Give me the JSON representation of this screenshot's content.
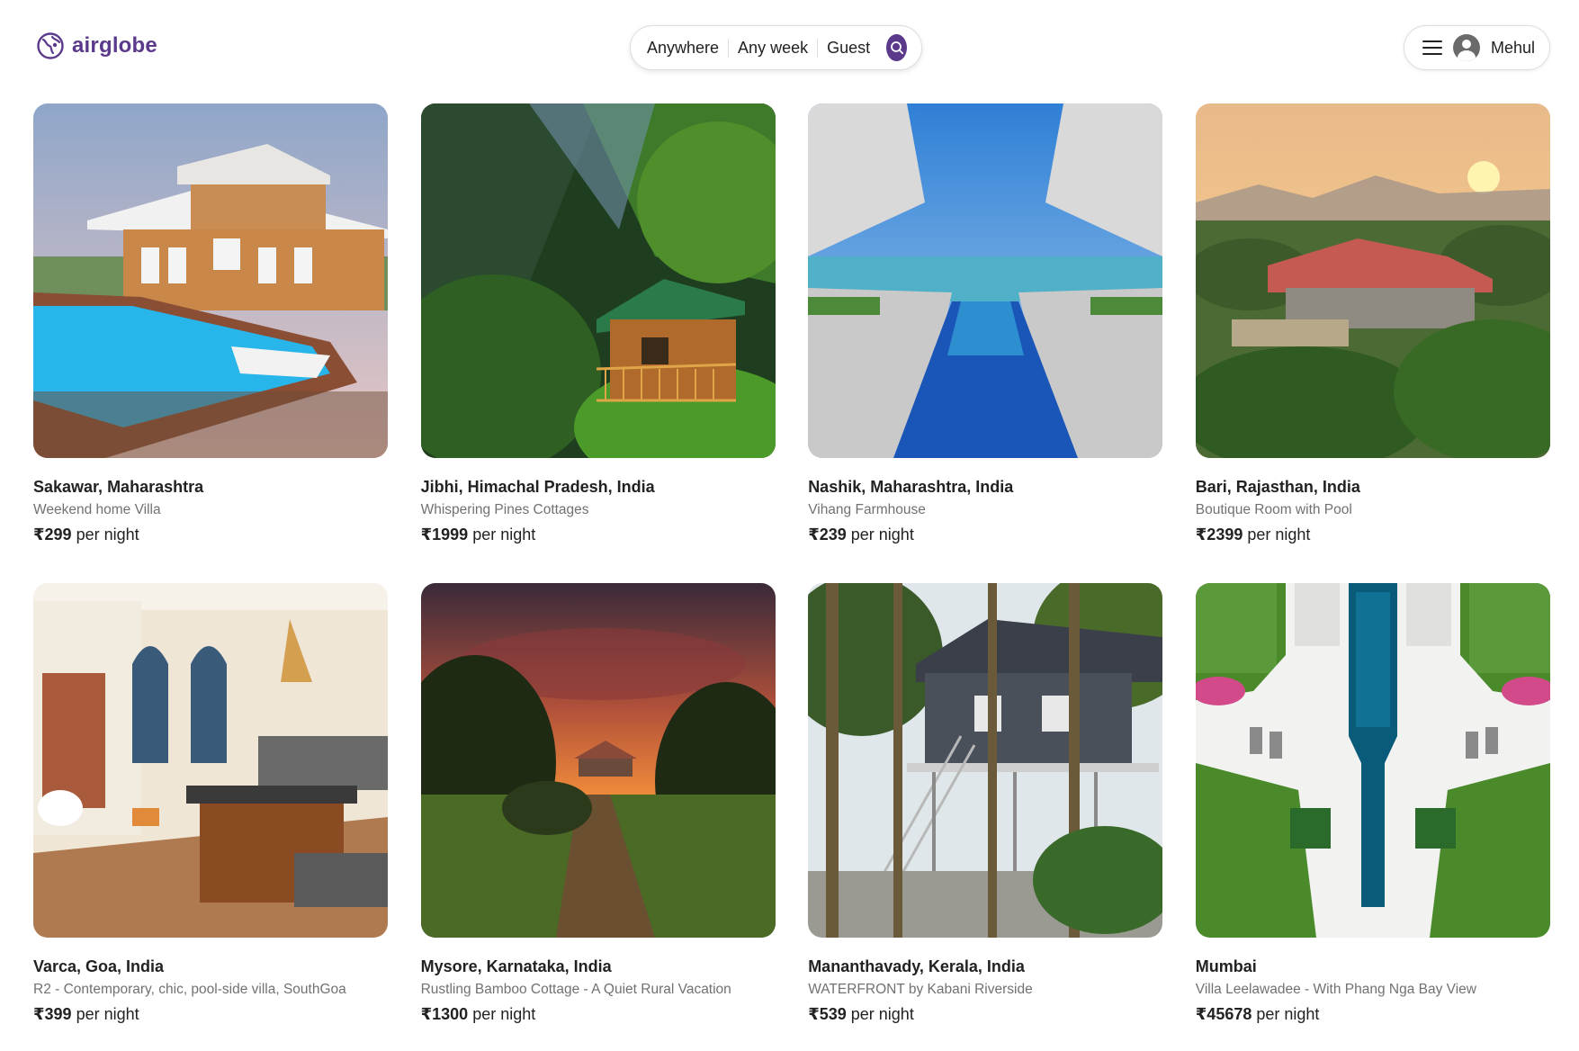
{
  "brand": {
    "name": "airglobe",
    "color": "#5b3a8c"
  },
  "search": {
    "segments": [
      "Anywhere",
      "Any week",
      "Guest"
    ],
    "icon": "search-icon"
  },
  "user": {
    "name": "Mehul",
    "menu_icon": "hamburger-icon",
    "avatar_icon": "avatar-icon"
  },
  "listings": [
    {
      "location": "Sakawar, Maharashtra",
      "title": "Weekend home Villa",
      "price": "₹299",
      "unit": "per night"
    },
    {
      "location": "Jibhi, Himachal Pradesh, India",
      "title": "Whispering Pines Cottages",
      "price": "₹1999",
      "unit": "per night"
    },
    {
      "location": "Nashik, Maharashtra, India",
      "title": "Vihang Farmhouse",
      "price": "₹239",
      "unit": "per night"
    },
    {
      "location": "Bari, Rajasthan, India",
      "title": "Boutique Room with Pool",
      "price": "₹2399",
      "unit": "per night"
    },
    {
      "location": "Varca, Goa, India",
      "title": "R2 - Contemporary, chic, pool-side villa, SouthGoa",
      "price": "₹399",
      "unit": "per night"
    },
    {
      "location": "Mysore, Karnataka, India",
      "title": "Rustling Bamboo Cottage - A Quiet Rural Vacation",
      "price": "₹1300",
      "unit": "per night"
    },
    {
      "location": "Mananthavady, Kerala, India",
      "title": "WATERFRONT by Kabani Riverside",
      "price": "₹539",
      "unit": "per night"
    },
    {
      "location": "Mumbai",
      "title": "Villa Leelawadee - With Phang Nga Bay View",
      "price": "₹45678",
      "unit": "per night"
    }
  ]
}
